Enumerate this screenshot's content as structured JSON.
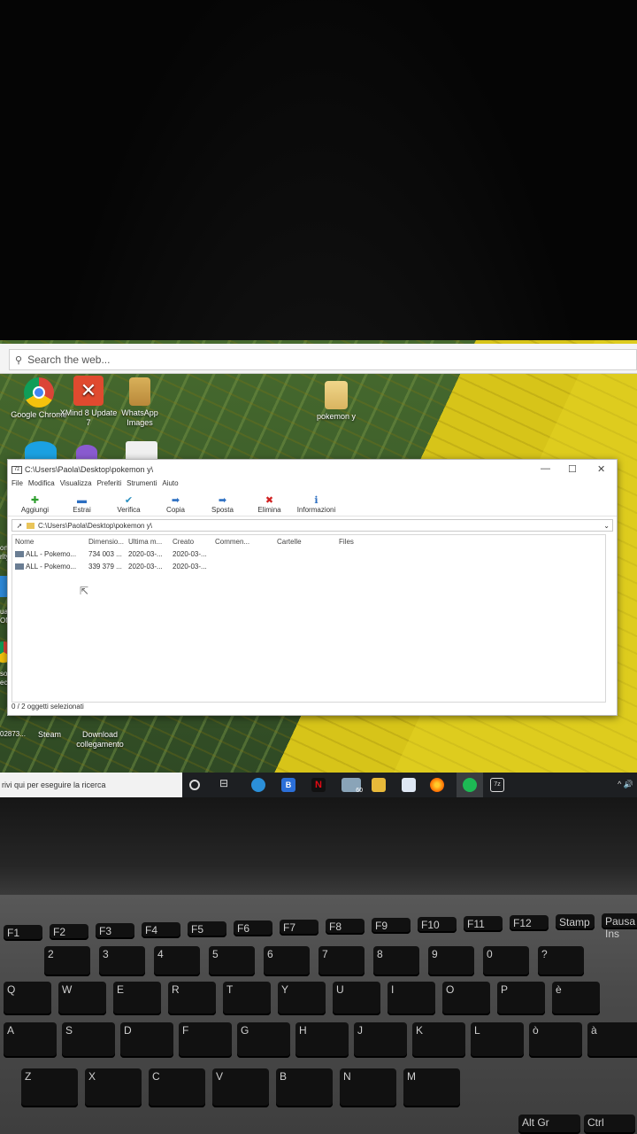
{
  "desktop": {
    "search": {
      "placeholder": "Search the web..."
    },
    "icons": [
      {
        "label": "Google Chrome"
      },
      {
        "label": "XMind 8 Update 7"
      },
      {
        "label": "WhatsApp Images"
      },
      {
        "label": "pokemon y"
      }
    ],
    "edge_labels": [
      "on",
      "rity",
      "ual",
      "ON",
      "son",
      "ect S",
      "02873..."
    ],
    "bottom_icons": [
      {
        "label": "Steam"
      },
      {
        "label": "Download collegamento"
      }
    ]
  },
  "window": {
    "title": "C:\\Users\\Paola\\Desktop\\pokemon y\\",
    "app_icon_text": "7z",
    "controls": {
      "minimize": "—",
      "maximize": "☐",
      "close": "✕"
    },
    "menu": [
      "File",
      "Modifica",
      "Visualizza",
      "Preferiti",
      "Strumenti",
      "Aiuto"
    ],
    "toolbar": [
      {
        "label": "Aggiungi",
        "icon": "plus-icon",
        "glyph": "✚",
        "color": "#2e9e2e"
      },
      {
        "label": "Estrai",
        "icon": "minus-icon",
        "glyph": "▬",
        "color": "#2d6fc2"
      },
      {
        "label": "Verifica",
        "icon": "check-icon",
        "glyph": "✔",
        "color": "#2a8fc0"
      },
      {
        "label": "Copia",
        "icon": "copy-arrow-icon",
        "glyph": "➡",
        "color": "#2d6fc2"
      },
      {
        "label": "Sposta",
        "icon": "move-arrow-icon",
        "glyph": "➡",
        "color": "#2d6fc2"
      },
      {
        "label": "Elimina",
        "icon": "delete-icon",
        "glyph": "✖",
        "color": "#d02020"
      },
      {
        "label": "Informazioni",
        "icon": "info-icon",
        "glyph": "ℹ",
        "color": "#2d6fc2"
      }
    ],
    "address": "C:\\Users\\Paola\\Desktop\\pokemon y\\",
    "columns": [
      "Nome",
      "Dimensio...",
      "Ultima m...",
      "Creato",
      "Commen...",
      "Cartelle",
      "Files"
    ],
    "rows": [
      [
        "ALL - Pokemo...",
        "734 003 ...",
        "2020-03-...",
        "2020-03-..."
      ],
      [
        "ALL - Pokemo...",
        "339 379 ...",
        "2020-03-...",
        "2020-03-..."
      ]
    ],
    "status": "0 / 2 oggetti selezionati"
  },
  "taskbar": {
    "search_placeholder": "rivi qui per eseguire la ricerca",
    "badge": "60",
    "tray": "^ 🔊"
  },
  "keyboard": {
    "fn_row": [
      "F1",
      "F2",
      "F3",
      "F4",
      "F5",
      "F6",
      "F7",
      "F8",
      "F9",
      "F10",
      "F11",
      "F12",
      "Stamp",
      "Pausa Ins"
    ],
    "num_row": [
      "2",
      "3",
      "4",
      "5",
      "6",
      "7",
      "8",
      "9",
      "0",
      "?"
    ],
    "row_q": [
      "Q",
      "W",
      "E",
      "R",
      "T",
      "Y",
      "U",
      "I",
      "O",
      "P",
      "è"
    ],
    "row_a": [
      "A",
      "S",
      "D",
      "F",
      "G",
      "H",
      "J",
      "K",
      "L",
      "ò",
      "à"
    ],
    "row_z": [
      "Z",
      "X",
      "C",
      "V",
      "B",
      "N",
      "M"
    ],
    "bottom": [
      "Alt Gr",
      "Ctrl"
    ]
  }
}
